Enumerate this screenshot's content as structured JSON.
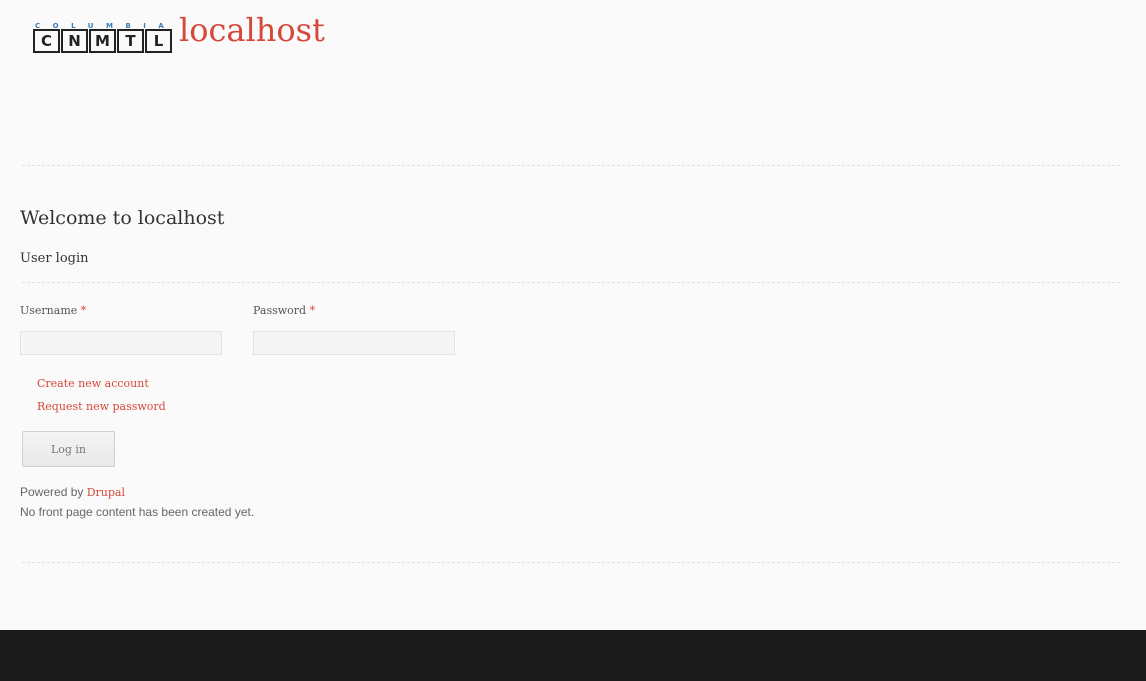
{
  "header": {
    "logo": {
      "top_text": "COLUMBIA",
      "letters": [
        "C",
        "N",
        "M",
        "T",
        "L"
      ]
    },
    "site_name": "localhost"
  },
  "main": {
    "page_title": "Welcome to localhost",
    "login_block": {
      "title": "User login",
      "username_label": "Username",
      "password_label": "Password",
      "required_marker": "*",
      "username_value": "",
      "password_value": "",
      "links": {
        "create_account": "Create new account",
        "request_password": "Request new password"
      },
      "submit_label": "Log in"
    },
    "powered_by_prefix": "Powered by",
    "powered_by_link": "Drupal",
    "no_content_message": "No front page content has been created yet."
  },
  "colors": {
    "accent": "#d5483a",
    "logo_blue": "#3b7bb8",
    "footer": "#1b1b1b",
    "background": "#fafafa"
  }
}
